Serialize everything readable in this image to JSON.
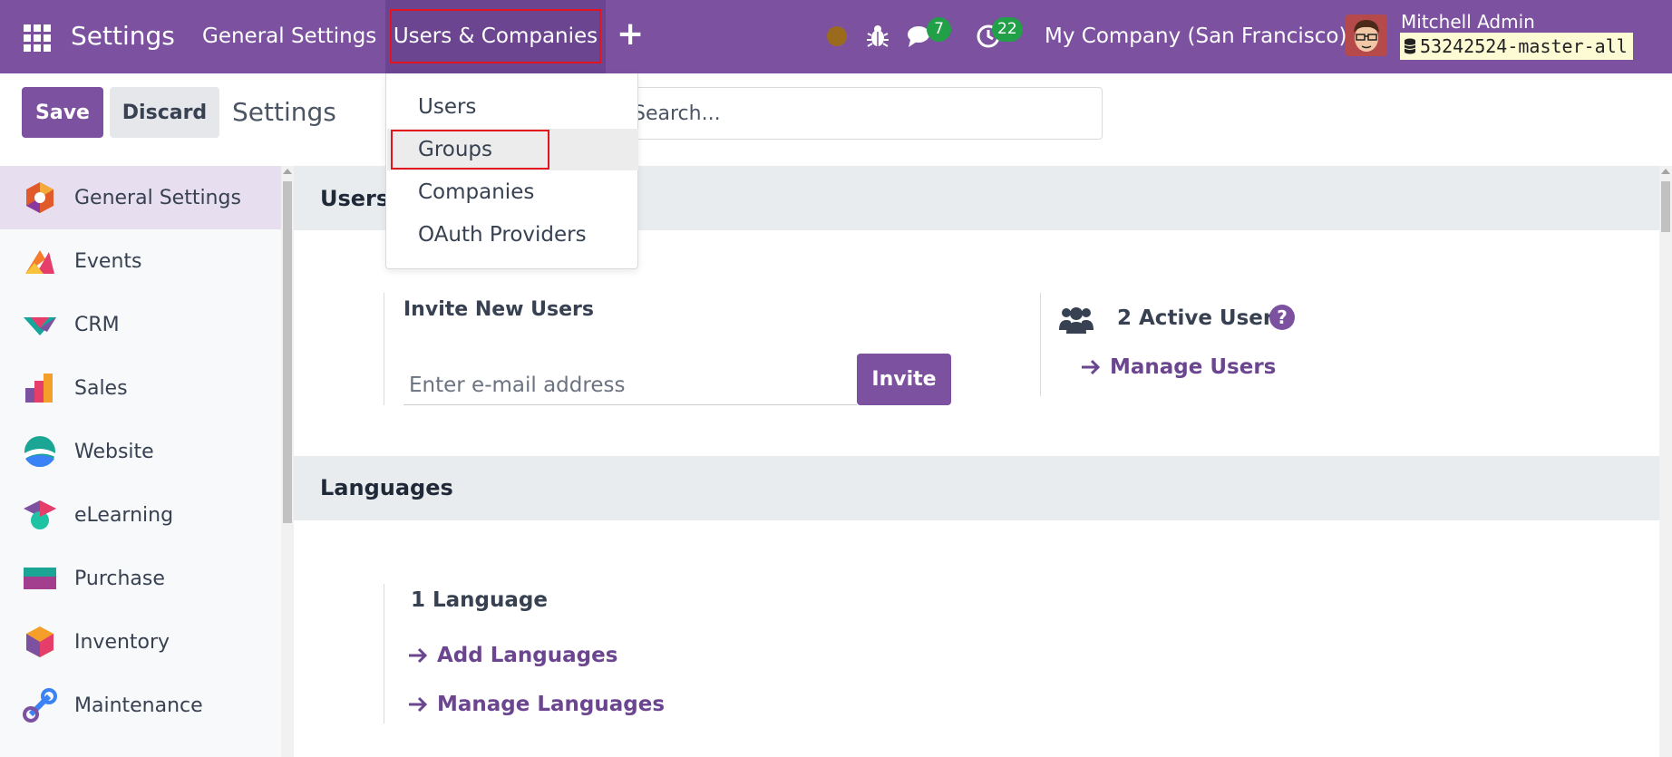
{
  "navbar": {
    "app_title": "Settings",
    "menus": [
      "General Settings",
      "Users & Companies"
    ],
    "plus": "+",
    "messages_count": "7",
    "activities_count": "22",
    "company": "My Company (San Francisco)",
    "user_name": "Mitchell Admin",
    "database": "53242524-master-all",
    "colors": {
      "brand": "#7c519f",
      "badge": "#21a048",
      "status": "#9a6b1d"
    }
  },
  "dropdown": {
    "items": [
      "Users",
      "Groups",
      "Companies",
      "OAuth Providers"
    ],
    "highlighted": "Groups"
  },
  "control_panel": {
    "save_label": "Save",
    "discard_label": "Discard",
    "breadcrumb": "Settings",
    "search_placeholder": "Search..."
  },
  "sidebar": {
    "items": [
      {
        "label": "General Settings",
        "icon": "general-settings-icon"
      },
      {
        "label": "Events",
        "icon": "events-icon"
      },
      {
        "label": "CRM",
        "icon": "crm-icon"
      },
      {
        "label": "Sales",
        "icon": "sales-icon"
      },
      {
        "label": "Website",
        "icon": "website-icon"
      },
      {
        "label": "eLearning",
        "icon": "elearning-icon"
      },
      {
        "label": "Purchase",
        "icon": "purchase-icon"
      },
      {
        "label": "Inventory",
        "icon": "inventory-icon"
      },
      {
        "label": "Maintenance",
        "icon": "maintenance-icon"
      }
    ],
    "active": "General Settings"
  },
  "users_section": {
    "title": "Users",
    "invite_label": "Invite New Users",
    "email_placeholder": "Enter e-mail address",
    "invite_button": "Invite",
    "active_users": "2 Active User",
    "help": "?",
    "manage_users": "Manage Users"
  },
  "languages_section": {
    "title": "Languages",
    "count": "1 Language",
    "add_languages": "Add Languages",
    "manage_languages": "Manage Languages"
  }
}
